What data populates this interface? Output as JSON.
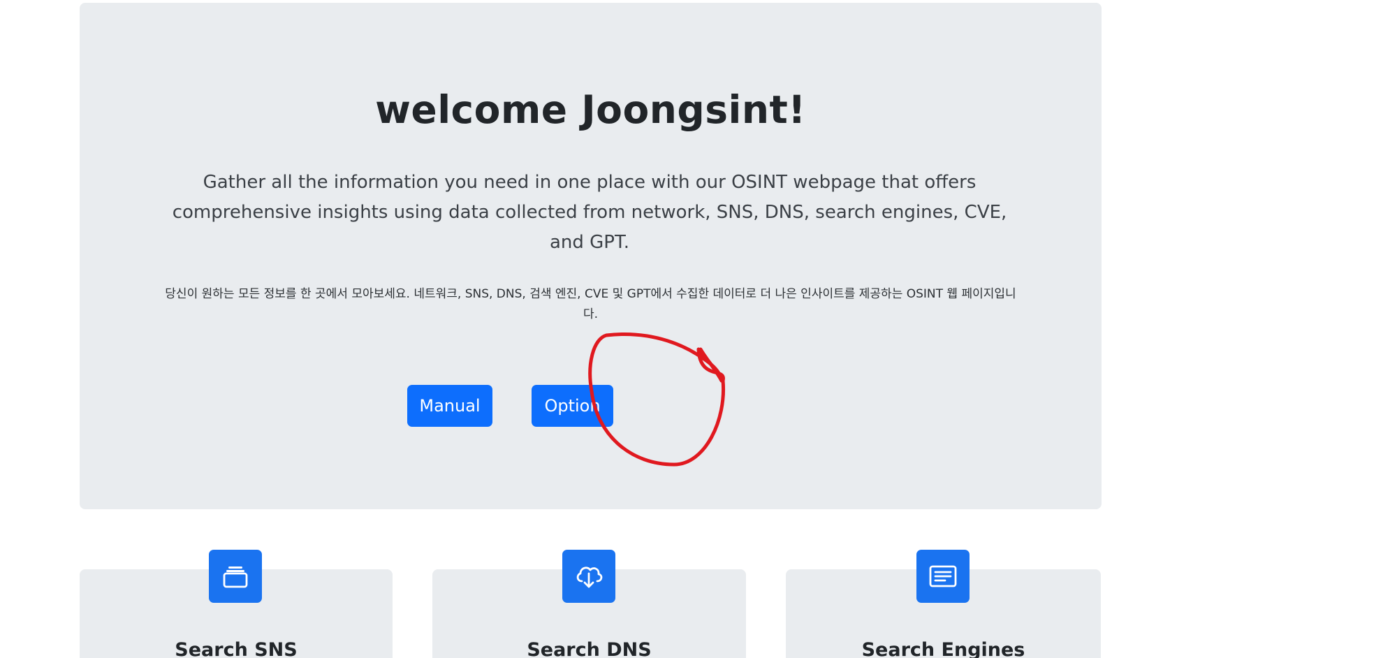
{
  "hero": {
    "title": "welcome Joongsint!",
    "lead": "Gather all the information you need in one place with our OSINT webpage that offers comprehensive insights using data collected from network, SNS, DNS, search engines, CVE, and GPT.",
    "korean": "당신이 원하는 모든 정보를 한 곳에서 모아보세요. 네트워크, SNS, DNS, 검색 엔진, CVE 및 GPT에서 수집한 데이터로 더 나은 인사이트를 제공하는 OSINT 웹 페이지입니다.",
    "buttons": {
      "manual_label": "Manual",
      "option_label": "Option"
    }
  },
  "features": [
    {
      "title": "Search SNS",
      "icon": "layers-icon"
    },
    {
      "title": "Search DNS",
      "icon": "cloud-download-icon"
    },
    {
      "title": "Search Engines",
      "icon": "card-text-icon"
    }
  ],
  "colors": {
    "primary": "#0d6efd",
    "panel": "#e9ecef",
    "annotation": "#e0191f"
  }
}
